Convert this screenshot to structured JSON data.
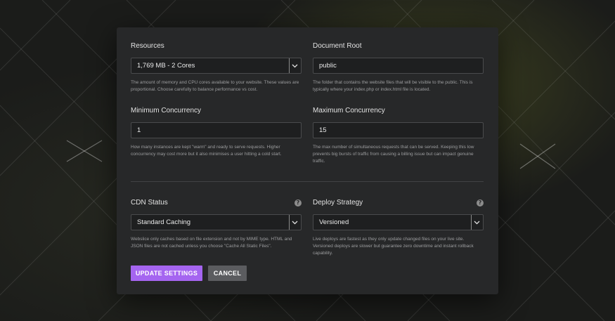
{
  "form": {
    "resources": {
      "label": "Resources",
      "value": "1,769 MB - 2 Cores",
      "help": "The amount of memory and CPU cores available to your website. These values are proportional. Choose carefully to balance performance vs cost."
    },
    "document_root": {
      "label": "Document Root",
      "value": "public",
      "help": "The folder that contains the website files that will be visible to the public. This is typically where your index.php or index.html file is located."
    },
    "min_concurrency": {
      "label": "Minimum Concurrency",
      "value": "1",
      "help": "How many instances are kept \"warm\" and ready to serve requests. Higher concurrency may cost more but it also minimises a user hitting a cold start."
    },
    "max_concurrency": {
      "label": "Maximum Concurrency",
      "value": "15",
      "help": "The max number of simultaneous requests that can be served. Keeping this low prevents big bursts of traffic from causing a billing issue but can impact genuine traffic."
    },
    "cdn_status": {
      "label": "CDN Status",
      "value": "Standard Caching",
      "help": "Webslice only caches based on file extension and not by MIME type. HTML and JSON files are not cached unless you choose \"Cache All Static Files\"."
    },
    "deploy_strategy": {
      "label": "Deploy Strategy",
      "value": "Versioned",
      "help": "Live deploys are fastest as they only update changed files on your live site. Versioned deploys are slower but guarantee zero downtime and instant rollback capability."
    },
    "help_icon_glyph": "?"
  },
  "actions": {
    "update_label": "UPDATE SETTINGS",
    "cancel_label": "CANCEL"
  },
  "colors": {
    "accent": "#a565f0",
    "panel": "#272829",
    "input_bg": "#1e1f20"
  }
}
